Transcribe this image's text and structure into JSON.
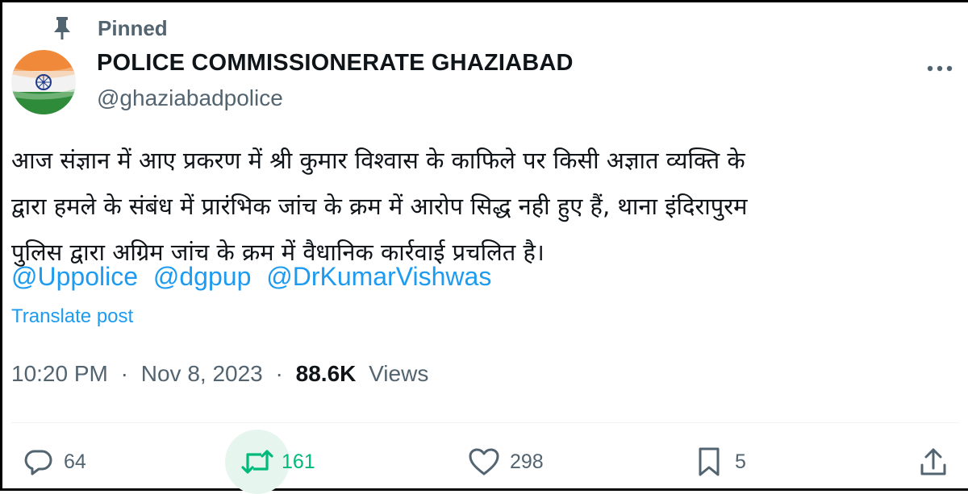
{
  "pinned_label": "Pinned",
  "author": {
    "display_name": "POLICE COMMISSIONERATE GHAZIABAD",
    "handle": "@ghaziabadpolice",
    "avatar_icon": "india-flag-icon"
  },
  "post": {
    "lines": [
      "आज संज्ञान में आए प्रकरण में श्री कुमार विश्वास के काफिले पर किसी अज्ञात व्यक्ति के",
      "द्वारा हमले के संबंध में प्रारंभिक जांच के क्रम में आरोप सिद्ध नही हुए हैं, थाना इंदिरापुरम",
      "पुलिस द्वारा अग्रिम जांच के क्रम में वैधानिक कार्रवाई प्रचलित है।"
    ],
    "mentions": [
      "@Uppolice",
      "@dgpup",
      "@DrKumarVishwas"
    ],
    "translate_label": "Translate post"
  },
  "meta": {
    "time": "10:20 PM",
    "separator": "·",
    "date": "Nov 8, 2023",
    "views_count": "88.6K",
    "views_label": "Views"
  },
  "actions": {
    "replies": "64",
    "reposts": "161",
    "likes": "298",
    "bookmarks": "5"
  },
  "colors": {
    "accent": "#1d9bf0",
    "repost_active": "#00ba7c",
    "text_primary": "#0f1419",
    "text_secondary": "#536471"
  }
}
